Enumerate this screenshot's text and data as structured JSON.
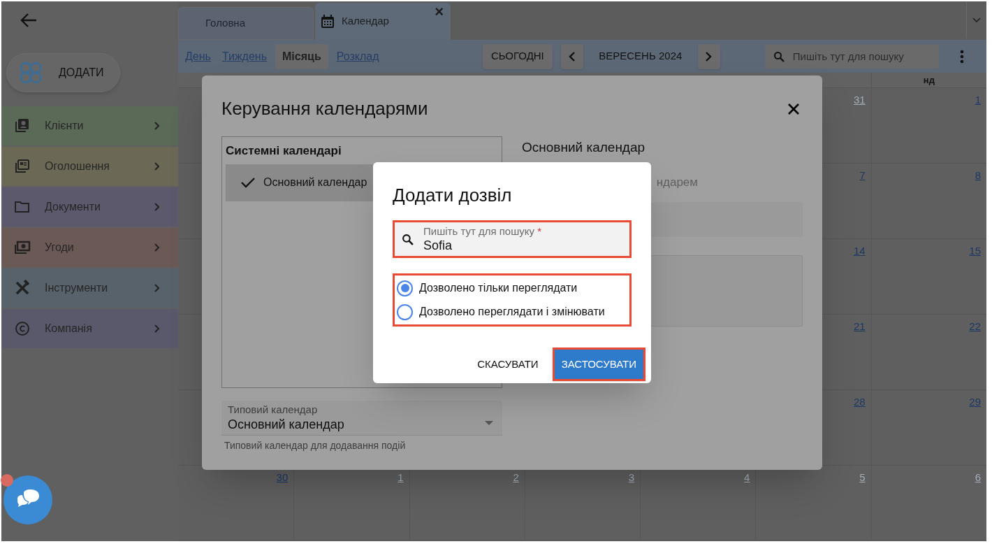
{
  "sidebar": {
    "add_button": "ДОДАТИ",
    "items": [
      {
        "label": "Клієнти",
        "color": "#5b6a57"
      },
      {
        "label": "Оголошення",
        "color": "#6b6955"
      },
      {
        "label": "Документи",
        "color": "#5d596c"
      },
      {
        "label": "Угоди",
        "color": "#6b5956"
      },
      {
        "label": "Інструменти",
        "color": "#57626b"
      },
      {
        "label": "Компанія",
        "color": "#5a596b"
      }
    ]
  },
  "tabs": [
    {
      "label": "Головна",
      "selected": false
    },
    {
      "label": "Календар",
      "selected": true,
      "close": "×"
    }
  ],
  "views": [
    {
      "label": "День",
      "selected": false
    },
    {
      "label": "Тиждень",
      "selected": false
    },
    {
      "label": "Місяць",
      "selected": true
    },
    {
      "label": "Розклад",
      "selected": false
    }
  ],
  "today_button": "СЬОГОДНІ",
  "period": "ВЕРЕСЕНЬ 2024",
  "search": {
    "placeholder": "Пишіть тут для пошуку"
  },
  "calendar": {
    "weekday_header": "нд",
    "weeks": [
      {
        "days": [
          {
            "day": "31",
            "other_month": true
          },
          {
            "day": "1",
            "other_month": false
          }
        ]
      },
      {
        "days": [
          {
            "day": "7",
            "other_month": false
          },
          {
            "day": "8",
            "other_month": false
          }
        ]
      },
      {
        "days": [
          {
            "day": "14",
            "other_month": false
          },
          {
            "day": "15",
            "other_month": false
          }
        ]
      },
      {
        "days": [
          {
            "day": "21",
            "other_month": false
          },
          {
            "day": "22",
            "other_month": false
          }
        ]
      },
      {
        "days": [
          {
            "day": "28",
            "other_month": false
          },
          {
            "day": "29",
            "other_month": false
          }
        ]
      },
      {
        "days": [
          {
            "day": "30",
            "other_month": false
          },
          {
            "day": "1",
            "other_month": true
          },
          {
            "day": "2",
            "other_month": true
          },
          {
            "day": "3",
            "other_month": true
          },
          {
            "day": "4",
            "other_month": true
          },
          {
            "day": "5",
            "other_month": true
          },
          {
            "day": "6",
            "other_month": true
          }
        ]
      }
    ]
  },
  "manage_dialog": {
    "title": "Керування календарями",
    "list_heading": "Системні календарі",
    "calendars": [
      {
        "label": "Основний календар",
        "selected": true
      }
    ],
    "detail_title": "Основний календар",
    "detail_hint": "ндарем",
    "default_select": {
      "label": "Типовий календар",
      "value": "Основний календар",
      "helper": "Типовий календар для додавання подій"
    }
  },
  "permission_dialog": {
    "title": "Додати дозвіл",
    "search": {
      "label": "Пишіть тут для пошуку",
      "required_mark": "*",
      "value": "Sofia"
    },
    "options": [
      {
        "label": "Дозволено тільки переглядати",
        "selected": true
      },
      {
        "label": "Дозволено переглядати і змінювати",
        "selected": false
      }
    ],
    "cancel": "СКАСУВАТИ",
    "apply": "ЗАСТОСУВАТИ"
  }
}
